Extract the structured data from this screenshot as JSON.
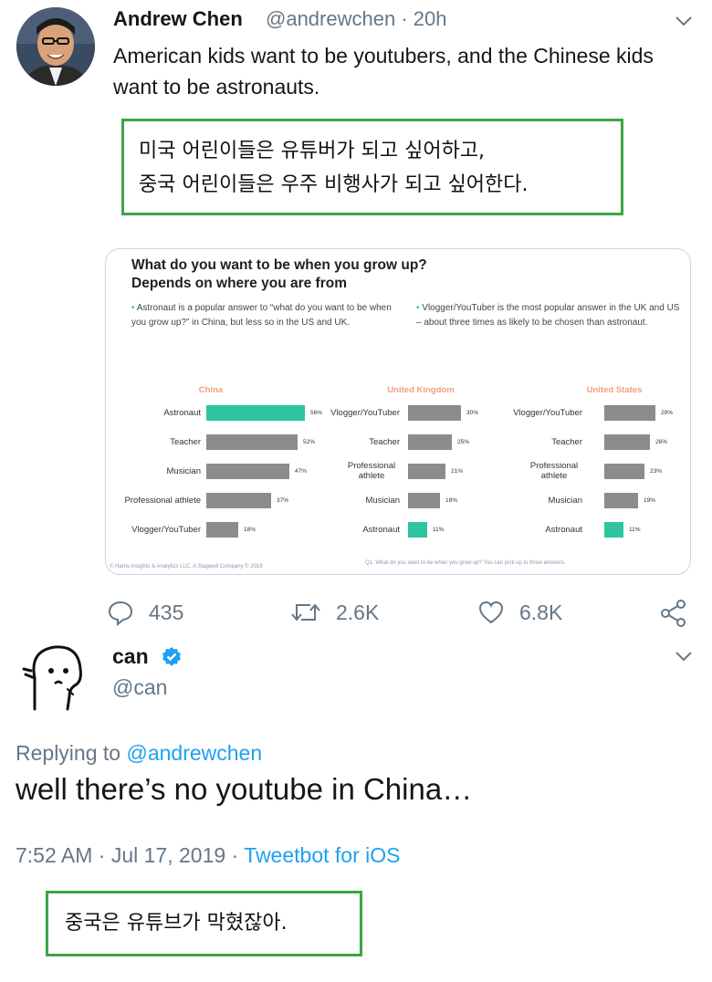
{
  "tweet1": {
    "author_name": "Andrew Chen",
    "handle": "@andrewchen",
    "separator": " · ",
    "time": "20h",
    "text": "American kids want to be youtubers, and the Chinese kids want to be astronauts.",
    "translation_line1": "미국 어린이들은 유튜버가 되고 싶어하고,",
    "translation_line2": "중국 어린이들은 우주 비행사가 되고 싶어한다.",
    "replies": "435",
    "retweets": "2.6K",
    "likes": "6.8K",
    "icons": [
      "chevron-down-icon",
      "reply-icon",
      "retweet-icon",
      "like-icon",
      "share-icon"
    ]
  },
  "chart_card": {
    "title": "What do you want to be when you grow up? Depends on where you are from",
    "bullet_left": "Astronaut is a popular answer to “what do you want to be when you grow up?” in China, but less so in the US and UK.",
    "bullet_right": "Vlogger/YouTuber is the most popular answer in the UK and US – about three times as likely to be chosen than astronaut.",
    "footnote_left": "© Harris Insights & Analytics LLC, A Stagwell Company © 2019",
    "footnote_right": "Q1. What do you want to be when you grow up? You can pick up to three answers."
  },
  "chart_data": [
    {
      "type": "bar",
      "title": "China",
      "categories": [
        "Astronaut",
        "Teacher",
        "Musician",
        "Professional athlete",
        "Vlogger/YouTuber"
      ],
      "values": [
        56,
        52,
        47,
        37,
        18
      ],
      "value_labels": [
        "56%",
        "52%",
        "47%",
        "37%",
        "18%"
      ],
      "highlight": "Astronaut",
      "colors": {
        "bar": "#8c8c8c",
        "highlight": "#2ec4a0",
        "title": "#f0a080"
      }
    },
    {
      "type": "bar",
      "title": "United Kingdom",
      "categories": [
        "Vlogger/YouTuber",
        "Teacher",
        "Professional athlete",
        "Musician",
        "Astronaut"
      ],
      "values": [
        30,
        25,
        21,
        18,
        11
      ],
      "value_labels": [
        "30%",
        "25%",
        "21%",
        "18%",
        "11%"
      ],
      "highlight": "Astronaut",
      "colors": {
        "bar": "#8c8c8c",
        "highlight": "#2ec4a0",
        "title": "#f0a080"
      }
    },
    {
      "type": "bar",
      "title": "United States",
      "categories": [
        "Vlogger/YouTuber",
        "Teacher",
        "Professional athlete",
        "Musician",
        "Astronaut"
      ],
      "values": [
        29,
        26,
        23,
        19,
        11
      ],
      "value_labels": [
        "29%",
        "26%",
        "23%",
        "19%",
        "11%"
      ],
      "highlight": "Astronaut",
      "colors": {
        "bar": "#8c8c8c",
        "highlight": "#2ec4a0",
        "title": "#f0a080"
      }
    }
  ],
  "tweet2": {
    "author_name": "can",
    "handle": "@can",
    "replying_prefix": "Replying to ",
    "replying_to": "@andrewchen",
    "text": "well there’s no youtube in China…",
    "timestamp": "7:52 AM · Jul 17, 2019 · ",
    "client": "Tweetbot for iOS",
    "translation": "중국은 유튜브가 막혔잖아.",
    "icons": [
      "verified-badge-icon",
      "chevron-down-icon"
    ]
  },
  "colors": {
    "link": "#1da1f2",
    "muted_text": "#657786",
    "translation_border": "#3aa547",
    "verified": "#1da1f2"
  }
}
